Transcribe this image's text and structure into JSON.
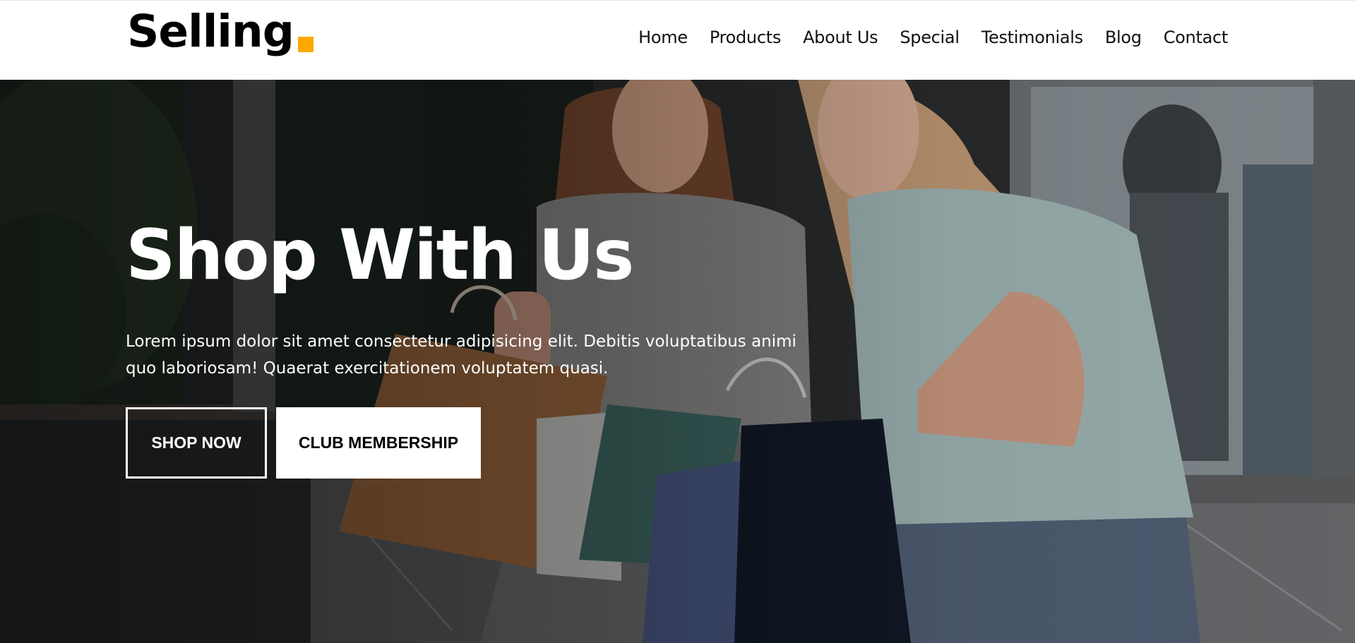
{
  "brand": {
    "name": "Selling",
    "accent_color": "#ffa800"
  },
  "nav": {
    "items": [
      {
        "label": "Home"
      },
      {
        "label": "Products"
      },
      {
        "label": "About Us"
      },
      {
        "label": "Special"
      },
      {
        "label": "Testimonials"
      },
      {
        "label": "Blog"
      },
      {
        "label": "Contact"
      }
    ]
  },
  "hero": {
    "title": "Shop With Us",
    "subtitle": "Lorem ipsum dolor sit amet consectetur adipisicing elit. Debitis voluptatibus animi quo laboriosam! Quaerat exercitationem voluptatem quasi.",
    "primary_button": "SHOP NOW",
    "secondary_button": "CLUB MEMBERSHIP",
    "background_image": "two-women-with-shopping-bags-photo"
  }
}
